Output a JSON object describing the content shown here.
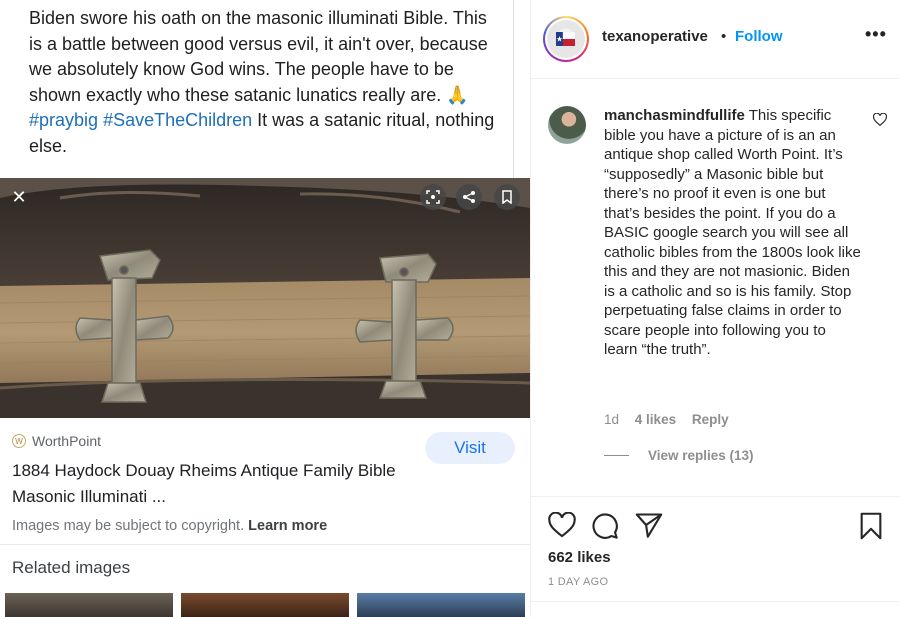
{
  "post_image": {
    "tweet_text_1": "Biden swore his oath on the masonic illuminati Bible. This is a battle between good versus evil, it ain't over, because we absolutely know God wins. The people have to be shown exactly who these satanic lunatics really are.",
    "tweet_emoji": "🙏",
    "hashtag_1": "#praybig",
    "hashtag_2": "#SaveTheChildren",
    "tweet_text_2": "It was a satanic ritual, nothing else.",
    "close_glyph": "✕",
    "source_name": "WorthPoint",
    "visit_label": "Visit",
    "result_title": "1884 Haydock Douay Rheims Antique Family Bible Masonic Illuminati ...",
    "copyright_text": "Images may be subject to copyright.",
    "learn_more": "Learn more",
    "related_label": "Related images"
  },
  "header": {
    "username": "texanoperative",
    "separator": "•",
    "follow_label": "Follow",
    "more_glyph": "•••"
  },
  "comment": {
    "username": "manchasmindfullife",
    "text": "This specific bible you have a picture of is an an antique shop called Worth Point. It’s “supposedly” a Masonic bible but there’s no proof it even is one but that’s besides the point. If you do a BASIC google search you will see all catholic bibles from the 1800s look like this and they are not masionic. Biden is a catholic and so is his family. Stop perpetuating false claims in order to scare people into following you to learn “the truth”.",
    "age": "1d",
    "likes": "4 likes",
    "reply_label": "Reply",
    "view_replies": "View replies (13)"
  },
  "footer": {
    "likes_count": "662 likes",
    "date": "1 DAY AGO"
  },
  "icons": {
    "like": "heart-icon",
    "comment": "comment-bubble-icon",
    "share": "paper-plane-icon",
    "save": "bookmark-icon"
  },
  "colors": {
    "follow_blue": "#0095f6",
    "hashtag_blue": "#1d6fb8",
    "visit_bg": "#e8f0fe",
    "visit_text": "#1a73e8"
  }
}
